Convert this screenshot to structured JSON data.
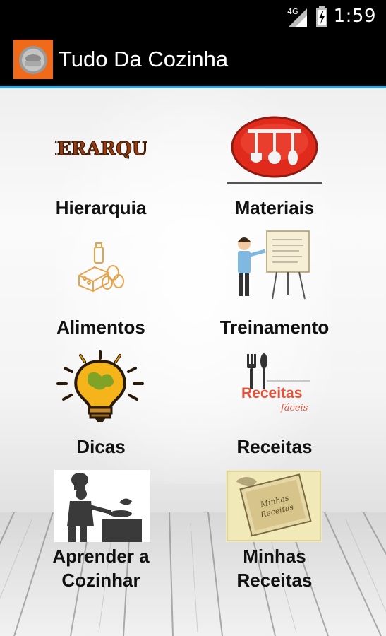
{
  "status_bar": {
    "network": "4G",
    "time": "1:59"
  },
  "app": {
    "title": "Tudo Da Cozinha"
  },
  "menu": {
    "hierarquia": {
      "label": "Hierarquia",
      "image_text": "HIERARQUIA"
    },
    "materiais": {
      "label": "Materiais"
    },
    "alimentos": {
      "label": "Alimentos"
    },
    "treinamento": {
      "label": "Treinamento"
    },
    "dicas": {
      "label": "Dicas"
    },
    "receitas": {
      "label": "Receitas",
      "image_text": "Receitas",
      "image_subtext": "fáceis"
    },
    "aprender": {
      "label_line1": "Aprender a",
      "label_line2": "Cozinhar"
    },
    "minhas": {
      "label_line1": "Minhas",
      "label_line2": "Receitas"
    }
  },
  "colors": {
    "accent_blue": "#2fa4d8",
    "action_bar": "#000000",
    "app_icon_bg": "#f06a1a"
  }
}
